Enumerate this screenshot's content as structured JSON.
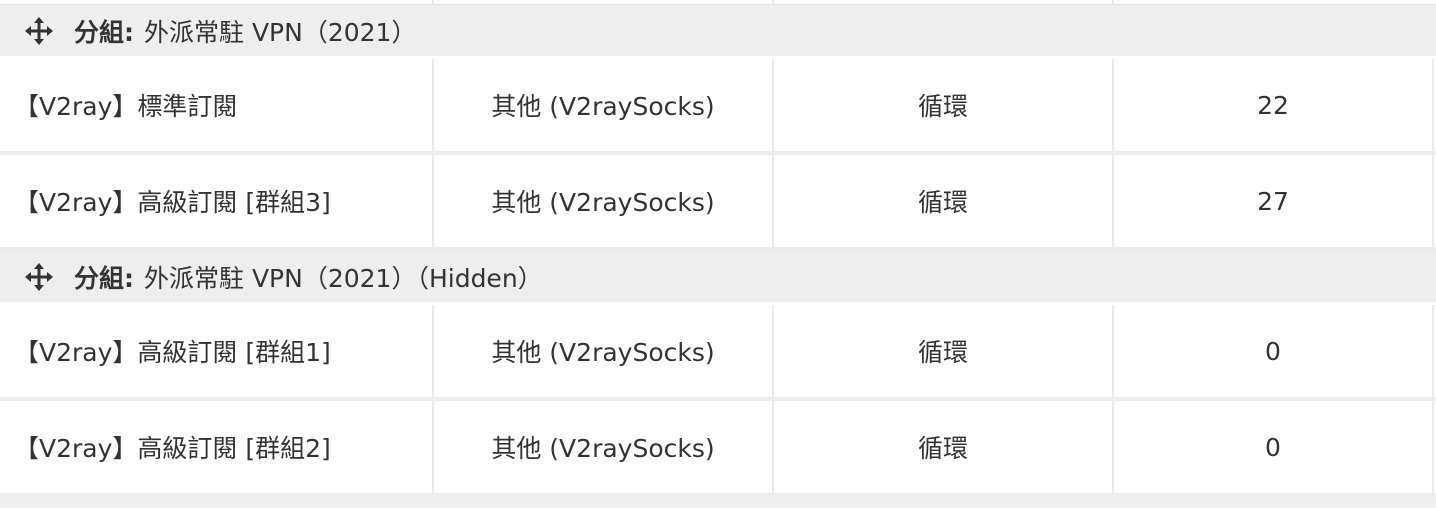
{
  "groups": [
    {
      "label": "分組:",
      "name": "外派常駐 VPN（2021）",
      "rows": [
        {
          "name": "【V2ray】標準訂閱",
          "module": "其他 (V2raySocks)",
          "billing": "循環",
          "count": "22"
        },
        {
          "name": "【V2ray】高級訂閱 [群組3]",
          "module": "其他 (V2raySocks)",
          "billing": "循環",
          "count": "27"
        }
      ]
    },
    {
      "label": "分組:",
      "name": "外派常駐 VPN（2021）（Hidden）",
      "rows": [
        {
          "name": "【V2ray】高級訂閱 [群組1]",
          "module": "其他 (V2raySocks)",
          "billing": "循環",
          "count": "0"
        },
        {
          "name": "【V2ray】高級訂閱 [群組2]",
          "module": "其他 (V2raySocks)",
          "billing": "循環",
          "count": "0"
        }
      ]
    }
  ],
  "icons": {
    "group_drag": "move-arrows-icon"
  },
  "colors": {
    "group_bg": "#eeeeee",
    "row_bg": "#ffffff",
    "border": "#e8e8e8",
    "text": "#333333"
  }
}
